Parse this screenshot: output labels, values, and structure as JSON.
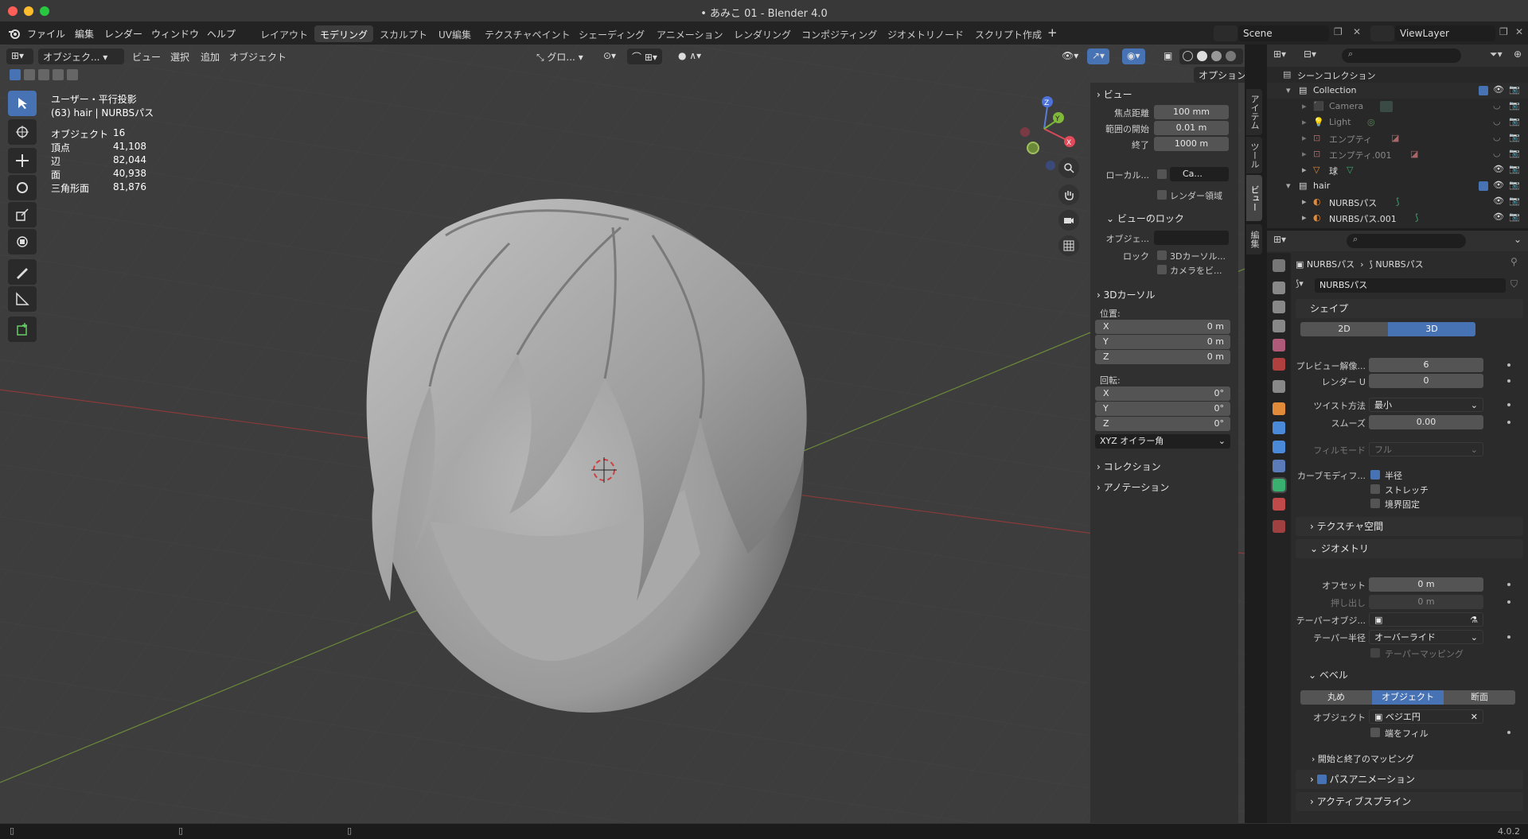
{
  "window": {
    "title": "• あみこ 01 - Blender 4.0"
  },
  "menu": {
    "items": [
      "ファイル",
      "編集",
      "レンダー",
      "ウィンドウ",
      "ヘルプ"
    ]
  },
  "workspaces": [
    "レイアウト",
    "モデリング",
    "スカルプト",
    "UV編集",
    "テクスチャペイント",
    "シェーディング",
    "アニメーション",
    "レンダリング",
    "コンポジティング",
    "ジオメトリノード",
    "スクリプト作成"
  ],
  "active_workspace": "モデリング",
  "scene": {
    "name": "Scene",
    "view_layer": "ViewLayer"
  },
  "viewport_header": {
    "mode": "オブジェク...",
    "menus": [
      "ビュー",
      "選択",
      "追加",
      "オブジェクト"
    ],
    "transform": "グロ...",
    "options": "オプション"
  },
  "overlay_text": {
    "view": "ユーザー・平行投影",
    "object": "(63) hair | NURBSパス"
  },
  "stats": [
    {
      "label": "オブジェクト",
      "value": "16"
    },
    {
      "label": "頂点",
      "value": "41,108"
    },
    {
      "label": "辺",
      "value": "82,044"
    },
    {
      "label": "面",
      "value": "40,938"
    },
    {
      "label": "三角形面",
      "value": "81,876"
    }
  ],
  "gizmo": {
    "x": "X",
    "y": "Y",
    "z": "Z"
  },
  "npanel": {
    "view_header": "ビュー",
    "focal_label": "焦点距離",
    "focal": "100 mm",
    "clip_start_label": "範囲の開始",
    "clip_start": "0.01 m",
    "clip_end_label": "終了",
    "clip_end": "1000 m",
    "local_label": "ローカル...",
    "local_cam": "Ca...",
    "render_region": "レンダー領域",
    "view_lock": "ビューのロック",
    "lock_obj_label": "オブジェ...",
    "lock_label": "ロック",
    "lock_3d": "3Dカーソル...",
    "lock_cam": "カメラをビ...",
    "cursor_header": "3Dカーソル",
    "location_label": "位置:",
    "loc": [
      {
        "axis": "X",
        "value": "0 m"
      },
      {
        "axis": "Y",
        "value": "0 m"
      },
      {
        "axis": "Z",
        "value": "0 m"
      }
    ],
    "rotation_label": "回転:",
    "rot": [
      {
        "axis": "X",
        "value": "0°"
      },
      {
        "axis": "Y",
        "value": "0°"
      },
      {
        "axis": "Z",
        "value": "0°"
      }
    ],
    "rot_mode": "XYZ オイラー角",
    "collection": "コレクション",
    "annotation": "アノテーション",
    "tabs": [
      "アイテム",
      "ツール",
      "ビュー",
      "編集"
    ]
  },
  "outliner": {
    "root": "シーンコレクション",
    "rows": [
      {
        "name": "Collection",
        "level": 1,
        "dim": false
      },
      {
        "name": "Camera",
        "level": 2,
        "dim": true
      },
      {
        "name": "Light",
        "level": 2,
        "dim": true
      },
      {
        "name": "エンプティ",
        "level": 2,
        "dim": true
      },
      {
        "name": "エンプティ.001",
        "level": 2,
        "dim": true
      },
      {
        "name": "球",
        "level": 2,
        "dim": false
      },
      {
        "name": "hair",
        "level": 1,
        "dim": false
      },
      {
        "name": "NURBSパス",
        "level": 2,
        "dim": false
      },
      {
        "name": "NURBSパス.001",
        "level": 2,
        "dim": false
      }
    ]
  },
  "properties": {
    "breadcrumb1": "NURBSパス",
    "breadcrumb2": "NURBSパス",
    "datablock": "NURBSパス",
    "shape": "シェイプ",
    "mode_2d": "2D",
    "mode_3d": "3D",
    "preview_label": "プレビュー解像...",
    "preview": "6",
    "render_u_label": "レンダー U",
    "render_u": "0",
    "twist_label": "ツイスト方法",
    "twist": "最小",
    "smooth_label": "スムーズ",
    "smooth": "0.00",
    "fill_label": "フィルモード",
    "fill": "フル",
    "curve_mod_label": "カーブモディフ...",
    "radius": "半径",
    "stretch": "ストレッチ",
    "bounds": "境界固定",
    "texture_space": "テクスチャ空間",
    "geometry": "ジオメトリ",
    "offset_label": "オフセット",
    "offset": "0 m",
    "extrude_label": "押し出し",
    "extrude": "0 m",
    "taper_obj_label": "テーパーオブジ...",
    "taper_radius_label": "テーパー半径",
    "taper_radius": "オーバーライド",
    "taper_mapping": "テーパーマッピング",
    "bevel": "ベベル",
    "bevel_round": "丸め",
    "bevel_object": "オブジェクト",
    "bevel_profile": "断面",
    "object_label": "オブジェクト",
    "object": "ベジエ円",
    "fill_caps": "端をフィル",
    "start_end": "開始と終了のマッピング",
    "path_anim": "パスアニメーション",
    "active_spline": "アクティブスプライン"
  },
  "status": {
    "version": "4.0.2"
  }
}
